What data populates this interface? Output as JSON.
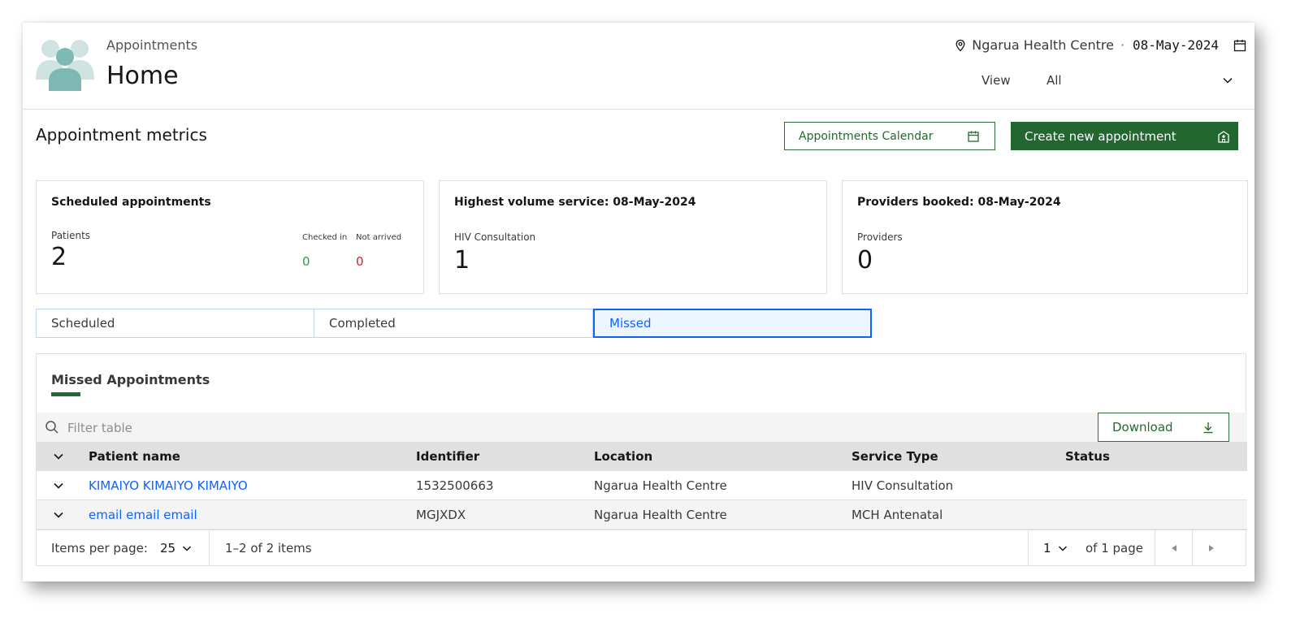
{
  "header": {
    "breadcrumb": "Appointments",
    "title": "Home",
    "location": "Ngarua Health Centre",
    "separator": "·",
    "date": "08-May-2024",
    "view_label": "View",
    "view_value": "All"
  },
  "metrics": {
    "title": "Appointment metrics",
    "calendar_button": "Appointments Calendar",
    "create_button": "Create new appointment",
    "cards": [
      {
        "title": "Scheduled appointments",
        "subtitle": "Patients",
        "value": "2",
        "checked_in_label": "Checked in",
        "checked_in_value": "0",
        "not_arrived_label": "Not arrived",
        "not_arrived_value": "0"
      },
      {
        "title": "Highest volume service: 08-May-2024",
        "subtitle": "HIV Consultation",
        "value": "1"
      },
      {
        "title": "Providers booked: 08-May-2024",
        "subtitle": "Providers",
        "value": "0"
      }
    ]
  },
  "tabs": [
    {
      "label": "Scheduled"
    },
    {
      "label": "Completed"
    },
    {
      "label": "Missed"
    }
  ],
  "selected_tab": "Missed",
  "table": {
    "title": "Missed Appointments",
    "search_placeholder": "Filter table",
    "download_label": "Download",
    "columns": [
      "Patient name",
      "Identifier",
      "Location",
      "Service Type",
      "Status"
    ],
    "rows": [
      {
        "name": "KIMAIYO KIMAIYO KIMAIYO",
        "identifier": "1532500663",
        "location": "Ngarua Health Centre",
        "service": "HIV Consultation",
        "status": ""
      },
      {
        "name": "email email email",
        "identifier": "MGJXDX",
        "location": "Ngarua Health Centre",
        "service": "MCH Antenatal",
        "status": ""
      }
    ]
  },
  "pagination": {
    "items_per_page_label": "Items per page:",
    "items_per_page": "25",
    "range": "1–2 of 2 items",
    "page": "1",
    "of_pages": "of 1 page"
  },
  "colors": {
    "brand_green": "#226630",
    "link_blue": "#0f62fe",
    "checked_in": "#24a148",
    "not_arrived": "#da1e28"
  }
}
